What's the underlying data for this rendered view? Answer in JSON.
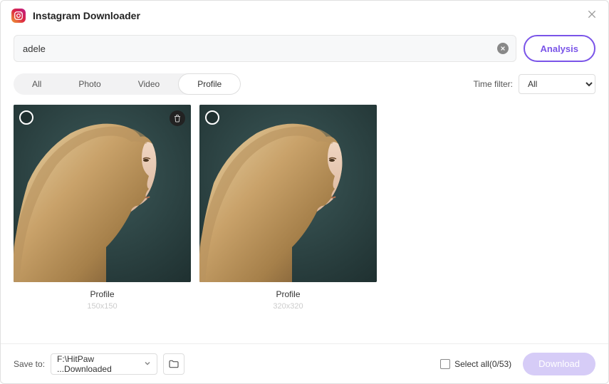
{
  "header": {
    "title": "Instagram Downloader"
  },
  "search": {
    "value": "adele"
  },
  "actions": {
    "analysis": "Analysis"
  },
  "tabs": {
    "items": [
      {
        "label": "All"
      },
      {
        "label": "Photo"
      },
      {
        "label": "Video"
      },
      {
        "label": "Profile"
      }
    ],
    "active_index": 3
  },
  "time_filter": {
    "label": "Time filter:",
    "selected": "All"
  },
  "results": [
    {
      "label": "Profile",
      "size": "150x150",
      "deletable": true
    },
    {
      "label": "Profile",
      "size": "320x320",
      "deletable": false
    }
  ],
  "footer": {
    "save_to_label": "Save to:",
    "save_to_path": "F:\\HitPaw ...Downloaded",
    "select_all_label": "Select all(0/53)",
    "download_label": "Download"
  },
  "icons": {
    "app": "instagram-logo-icon",
    "close": "close-icon",
    "clear": "clear-icon",
    "delete": "trash-icon",
    "folder": "folder-icon",
    "chevron": "chevron-down-icon"
  }
}
